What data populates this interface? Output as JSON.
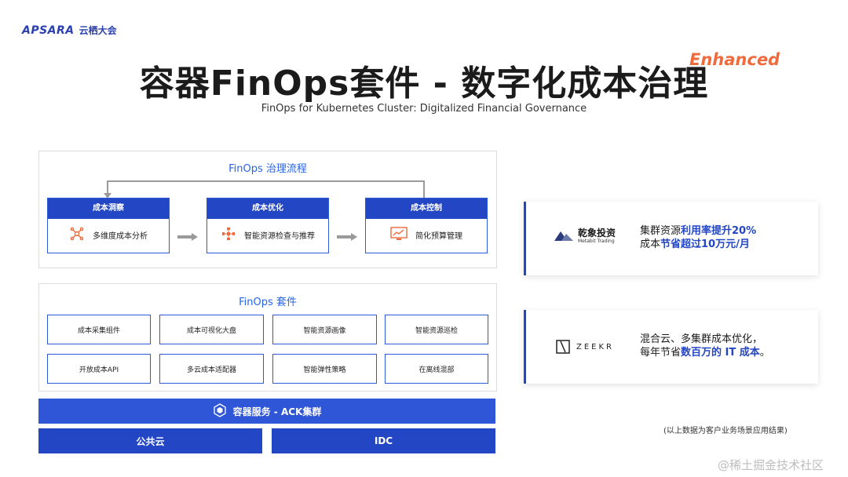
{
  "brand": {
    "logo_en": "APSARA",
    "logo_cn": "云栖大会"
  },
  "header": {
    "title": "容器FinOps套件 - 数字化成本治理",
    "tag": "Enhanced",
    "subtitle": "FinOps for Kubernetes Cluster: Digitalized Financial Governance"
  },
  "process": {
    "title": "FinOps 治理流程",
    "steps": [
      {
        "head": "成本洞察",
        "label": "多维度成本分析",
        "icon": "network-icon"
      },
      {
        "head": "成本优化",
        "label": "智能资源检查与推荐",
        "icon": "optimize-icon"
      },
      {
        "head": "成本控制",
        "label": "简化预算管理",
        "icon": "budget-chart-icon"
      }
    ]
  },
  "suite": {
    "title": "FinOps 套件",
    "items": [
      "成本采集组件",
      "成本可视化大盘",
      "智能资源画像",
      "智能资源巡检",
      "开放成本API",
      "多云成本适配器",
      "智能弹性策略",
      "在离线混部"
    ]
  },
  "infra": {
    "ack_label": "容器服务 - ACK集群",
    "public_cloud": "公共云",
    "idc": "IDC"
  },
  "cases": [
    {
      "company_cn": "乾象投资",
      "company_en": "Metabit Trading",
      "line1_prefix": "集群资源",
      "line1_hl": "利用率提升20%",
      "line2_prefix": "成本",
      "line2_hl": "节省超过10万元/月"
    },
    {
      "company": "ZEEKR",
      "line1": "混合云、多集群成本优化，",
      "line2_prefix": "每年节省",
      "line2_hl": "数百万的 IT 成本",
      "line2_suffix": "。"
    }
  ],
  "footnote": "(以上数据为客户业务场景应用结果)",
  "watermark": "@稀土掘金技术社区",
  "colors": {
    "primary": "#2346c5",
    "accent": "#f06a3c",
    "panel_title": "#2563eb"
  }
}
